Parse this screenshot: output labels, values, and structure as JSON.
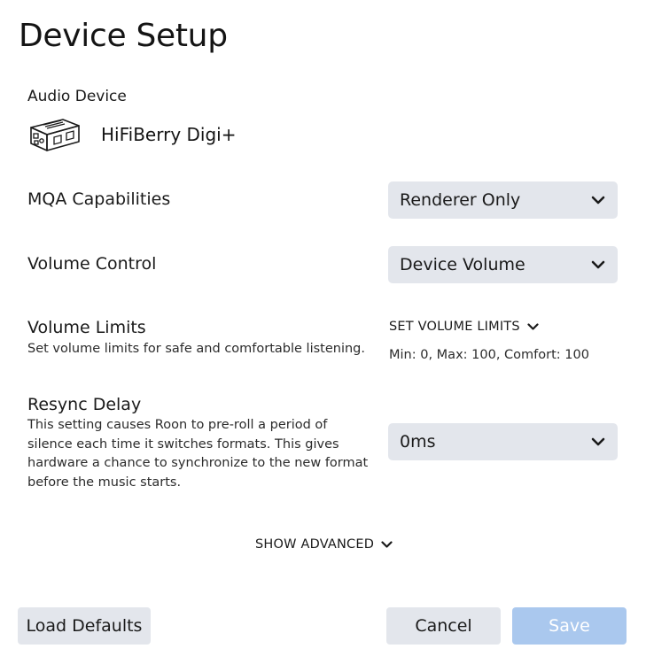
{
  "page_title": "Device Setup",
  "audio_device": {
    "label": "Audio Device",
    "name": "HiFiBerry Digi+",
    "icon": "audio-device-icon"
  },
  "mqa": {
    "label": "MQA Capabilities",
    "value": "Renderer Only"
  },
  "volume_control": {
    "label": "Volume Control",
    "value": "Device Volume"
  },
  "volume_limits": {
    "label": "Volume Limits",
    "description": "Set volume limits for safe and comfortable listening.",
    "button_label": "SET VOLUME LIMITS",
    "summary": "Min: 0, Max: 100, Comfort: 100"
  },
  "resync_delay": {
    "label": "Resync Delay",
    "description_lines": [
      "This setting causes Roon to pre-roll a period of",
      "silence each time it switches formats. This gives",
      "hardware a chance to synchronize to the new format",
      "before the music starts."
    ],
    "value": "0ms"
  },
  "show_advanced_label": "SHOW ADVANCED",
  "footer": {
    "load_defaults": "Load Defaults",
    "cancel": "Cancel",
    "save": "Save"
  },
  "colors": {
    "select_bg": "#e3e6ec",
    "save_bg_disabled": "#aac8ee"
  }
}
